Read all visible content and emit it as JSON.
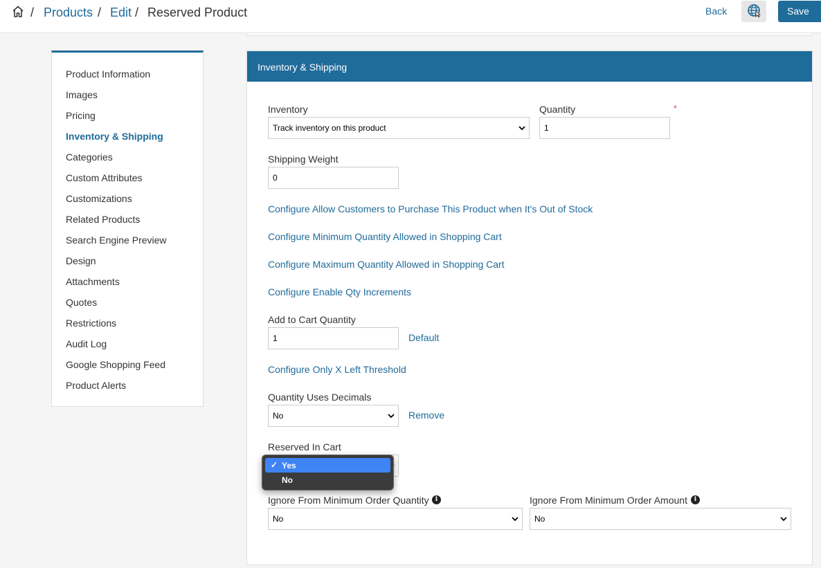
{
  "breadcrumb": {
    "products": "Products",
    "edit": "Edit",
    "current": "Reserved Product",
    "separator": "/"
  },
  "header": {
    "back_label": "Back",
    "save_label": "Save"
  },
  "sidebar": {
    "items": [
      {
        "label": "Product Information",
        "active": false
      },
      {
        "label": "Images",
        "active": false
      },
      {
        "label": "Pricing",
        "active": false
      },
      {
        "label": "Inventory & Shipping",
        "active": true
      },
      {
        "label": "Categories",
        "active": false
      },
      {
        "label": "Custom Attributes",
        "active": false
      },
      {
        "label": "Customizations",
        "active": false
      },
      {
        "label": "Related Products",
        "active": false
      },
      {
        "label": "Search Engine Preview",
        "active": false
      },
      {
        "label": "Design",
        "active": false
      },
      {
        "label": "Attachments",
        "active": false
      },
      {
        "label": "Quotes",
        "active": false
      },
      {
        "label": "Restrictions",
        "active": false
      },
      {
        "label": "Audit Log",
        "active": false
      },
      {
        "label": "Google Shopping Feed",
        "active": false
      },
      {
        "label": "Product Alerts",
        "active": false
      }
    ]
  },
  "panel": {
    "title": "Inventory & Shipping",
    "inventory": {
      "label": "Inventory",
      "value": "Track inventory on this product"
    },
    "quantity": {
      "label": "Quantity",
      "value": "1",
      "required_mark": "*"
    },
    "shipping_weight": {
      "label": "Shipping Weight",
      "value": "0"
    },
    "links": {
      "out_of_stock": "Configure Allow Customers to Purchase This Product when It's Out of Stock",
      "min_qty": "Configure Minimum Quantity Allowed in Shopping Cart",
      "max_qty": "Configure Maximum Quantity Allowed in Shopping Cart",
      "qty_increments": "Configure Enable Qty Increments",
      "only_x_left": "Configure Only X Left Threshold"
    },
    "add_to_cart_qty": {
      "label": "Add to Cart Quantity",
      "value": "1",
      "action": "Default"
    },
    "qty_decimals": {
      "label": "Quantity Uses Decimals",
      "value": "No",
      "action": "Remove"
    },
    "reserved_in_cart": {
      "label": "Reserved In Cart",
      "options": [
        {
          "label": "Yes",
          "selected": true
        },
        {
          "label": "No",
          "selected": false
        }
      ]
    },
    "ignore_min_qty": {
      "label": "Ignore From Minimum Order Quantity",
      "value": "No"
    },
    "ignore_min_amount": {
      "label": "Ignore From Minimum Order Amount",
      "value": "No"
    }
  },
  "colors": {
    "accent": "#1f6b9a",
    "highlight": "#3f84f5",
    "required": "#d9534f"
  }
}
